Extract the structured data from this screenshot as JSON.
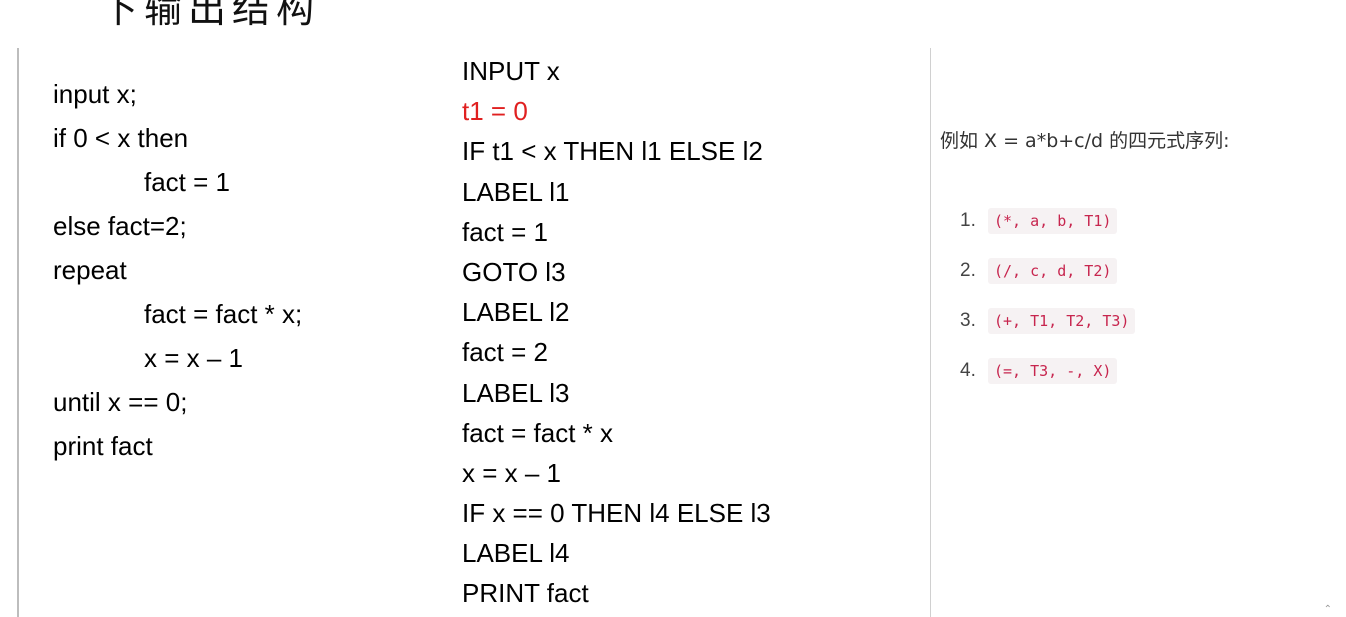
{
  "heading": "下输出结构",
  "source_code": [
    {
      "text": "input x;",
      "indent": false
    },
    {
      "text": "if 0 < x then",
      "indent": false
    },
    {
      "text": "fact = 1",
      "indent": true
    },
    {
      "text": "else fact=2;",
      "indent": false
    },
    {
      "text": "repeat",
      "indent": false
    },
    {
      "text": "fact = fact * x;",
      "indent": true
    },
    {
      "text": "x = x – 1",
      "indent": true
    },
    {
      "text": "until x == 0;",
      "indent": false
    },
    {
      "text": "print fact",
      "indent": false
    }
  ],
  "intermediate_code": [
    {
      "text": "INPUT x",
      "highlight": false
    },
    {
      "text": "t1 = 0",
      "highlight": true
    },
    {
      "text": "IF t1 < x THEN l1 ELSE l2",
      "highlight": false
    },
    {
      "text": "LABEL l1",
      "highlight": false
    },
    {
      "text": "fact = 1",
      "highlight": false
    },
    {
      "text": "GOTO l3",
      "highlight": false
    },
    {
      "text": "LABEL l2",
      "highlight": false
    },
    {
      "text": "fact = 2",
      "highlight": false
    },
    {
      "text": "LABEL l3",
      "highlight": false
    },
    {
      "text": "fact = fact * x",
      "highlight": false
    },
    {
      "text": "x = x – 1",
      "highlight": false
    },
    {
      "text": "IF x == 0 THEN l4 ELSE l3",
      "highlight": false
    },
    {
      "text": "LABEL l4",
      "highlight": false
    },
    {
      "text": "PRINT fact",
      "highlight": false
    }
  ],
  "quadruple_panel": {
    "intro": "例如 X = a*b+c/d 的四元式序列:",
    "items": [
      {
        "num": "1.",
        "code": "(*, a, b, T1)"
      },
      {
        "num": "2.",
        "code": "(/, c, d, T2)"
      },
      {
        "num": "3.",
        "code": "(+, T1, T2, T3)"
      },
      {
        "num": "4.",
        "code": "(=, T3, -, X)"
      }
    ]
  },
  "colors": {
    "highlight": "#e02020",
    "code_text": "#c7254e",
    "code_bg": "#f6f2f3"
  }
}
